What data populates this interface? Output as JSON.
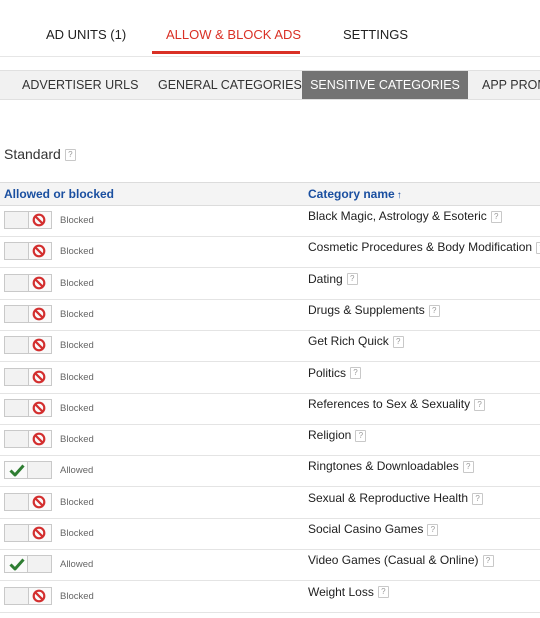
{
  "top_tabs": [
    {
      "label": "AD UNITS (1)"
    },
    {
      "label": "ALLOW & BLOCK ADS"
    },
    {
      "label": "SETTINGS"
    }
  ],
  "sub_tabs": [
    {
      "label": "ADVERTISER URLS"
    },
    {
      "label": "GENERAL CATEGORIES"
    },
    {
      "label": "SENSITIVE CATEGORIES"
    },
    {
      "label": "APP PROM"
    }
  ],
  "section": {
    "title": "Standard",
    "help": "?"
  },
  "table": {
    "col_status": "Allowed or blocked",
    "col_category": "Category name",
    "sort_arrow": "↑",
    "rows": [
      {
        "status": "Blocked",
        "category": "Black Magic, Astrology & Esoteric",
        "help": "?"
      },
      {
        "status": "Blocked",
        "category": "Cosmetic Procedures & Body Modification",
        "help": "?"
      },
      {
        "status": "Blocked",
        "category": "Dating",
        "help": "?"
      },
      {
        "status": "Blocked",
        "category": "Drugs & Supplements",
        "help": "?"
      },
      {
        "status": "Blocked",
        "category": "Get Rich Quick",
        "help": "?"
      },
      {
        "status": "Blocked",
        "category": "Politics",
        "help": "?"
      },
      {
        "status": "Blocked",
        "category": "References to Sex & Sexuality",
        "help": "?"
      },
      {
        "status": "Blocked",
        "category": "Religion",
        "help": "?"
      },
      {
        "status": "Allowed",
        "category": "Ringtones & Downloadables",
        "help": "?"
      },
      {
        "status": "Blocked",
        "category": "Sexual & Reproductive Health",
        "help": "?"
      },
      {
        "status": "Blocked",
        "category": "Social Casino Games",
        "help": "?"
      },
      {
        "status": "Allowed",
        "category": "Video Games (Casual & Online)",
        "help": "?"
      },
      {
        "status": "Blocked",
        "category": "Weight Loss",
        "help": "?"
      }
    ]
  },
  "colors": {
    "accent": "#d93025",
    "blocked_icon": "#d32f2f",
    "allowed_icon": "#2e7d32",
    "header_link": "#1a4fa0"
  }
}
